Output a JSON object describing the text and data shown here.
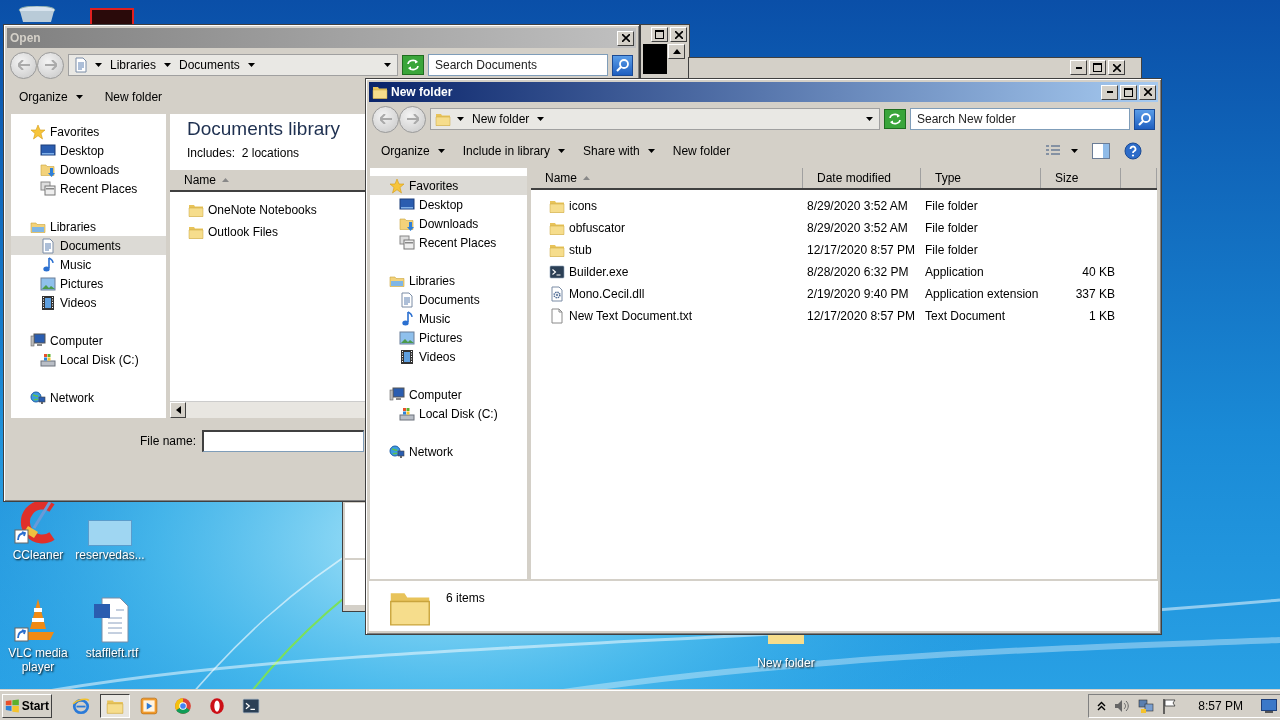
{
  "desktop": {
    "icons": [
      {
        "label": "CCleaner",
        "kind": "ccleaner",
        "shortcut": true
      },
      {
        "label": "reservedas...",
        "kind": "blank",
        "shortcut": false
      },
      {
        "label": "VLC media player",
        "kind": "vlc",
        "shortcut": true
      },
      {
        "label": "staffleft.rtf",
        "kind": "word",
        "shortcut": false
      },
      {
        "label": "New folder",
        "kind": "folder",
        "shortcut": false
      }
    ]
  },
  "open_dialog": {
    "title": "Open",
    "active": false,
    "address": {
      "kind": "documents",
      "crumbs": [
        "Libraries",
        "Documents"
      ]
    },
    "search_placeholder": "Search Documents",
    "toolbar": [
      {
        "label": "Organize",
        "dropdown": true
      },
      {
        "label": "New folder",
        "dropdown": false
      }
    ],
    "nav": [
      {
        "label": "Favorites",
        "kind": "star",
        "selected": false,
        "children": [
          {
            "label": "Desktop",
            "kind": "desktop",
            "selected": false
          },
          {
            "label": "Downloads",
            "kind": "downloads",
            "selected": false
          },
          {
            "label": "Recent Places",
            "kind": "recent",
            "selected": false
          }
        ]
      },
      {
        "label": "Libraries",
        "kind": "library",
        "selected": false,
        "children": [
          {
            "label": "Documents",
            "kind": "documents",
            "selected": true
          },
          {
            "label": "Music",
            "kind": "music",
            "selected": false
          },
          {
            "label": "Pictures",
            "kind": "pictures",
            "selected": false
          },
          {
            "label": "Videos",
            "kind": "videos",
            "selected": false
          }
        ]
      },
      {
        "label": "Computer",
        "kind": "computer",
        "selected": false,
        "children": [
          {
            "label": "Local Disk (C:)",
            "kind": "disk",
            "selected": false
          }
        ]
      },
      {
        "label": "Network",
        "kind": "network",
        "selected": false
      }
    ],
    "library_title": "Documents library",
    "includes_label": "Includes:",
    "locations_link": "2 locations",
    "columns": [
      {
        "label": "Name",
        "sorted": true
      }
    ],
    "items": [
      {
        "kind": "folder",
        "name": "OneNote Notebooks"
      },
      {
        "kind": "folder",
        "name": "Outlook Files"
      }
    ],
    "file_name_label": "File name:"
  },
  "explorer": {
    "title": "New folder",
    "active": true,
    "address": {
      "kind": "folder",
      "crumbs": [
        "New folder"
      ]
    },
    "search_placeholder": "Search New folder",
    "toolbar": [
      {
        "label": "Organize",
        "dropdown": true
      },
      {
        "label": "Include in library",
        "dropdown": true
      },
      {
        "label": "Share with",
        "dropdown": true
      },
      {
        "label": "New folder",
        "dropdown": false
      }
    ],
    "nav": [
      {
        "label": "Favorites",
        "kind": "star",
        "selected": true,
        "children": [
          {
            "label": "Desktop",
            "kind": "desktop",
            "selected": false
          },
          {
            "label": "Downloads",
            "kind": "downloads",
            "selected": false
          },
          {
            "label": "Recent Places",
            "kind": "recent",
            "selected": false
          }
        ]
      },
      {
        "label": "Libraries",
        "kind": "library",
        "selected": false,
        "children": [
          {
            "label": "Documents",
            "kind": "documents",
            "selected": false
          },
          {
            "label": "Music",
            "kind": "music",
            "selected": false
          },
          {
            "label": "Pictures",
            "kind": "pictures",
            "selected": false
          },
          {
            "label": "Videos",
            "kind": "videos",
            "selected": false
          }
        ]
      },
      {
        "label": "Computer",
        "kind": "computer",
        "selected": false,
        "children": [
          {
            "label": "Local Disk (C:)",
            "kind": "disk",
            "selected": false
          }
        ]
      },
      {
        "label": "Network",
        "kind": "network",
        "selected": false
      }
    ],
    "columns": [
      {
        "label": "Name",
        "sorted": true
      },
      {
        "label": "Date modified",
        "sorted": false
      },
      {
        "label": "Type",
        "sorted": false
      },
      {
        "label": "Size",
        "sorted": false
      }
    ],
    "rows": [
      {
        "kind": "folder",
        "name": "icons",
        "date": "8/29/2020 3:52 AM",
        "type": "File folder"
      },
      {
        "kind": "folder",
        "name": "obfuscator",
        "date": "8/29/2020 3:52 AM",
        "type": "File folder"
      },
      {
        "kind": "folder",
        "name": "stub",
        "date": "12/17/2020 8:57 PM",
        "type": "File folder"
      },
      {
        "kind": "exe",
        "name": "Builder.exe",
        "date": "8/28/2020 6:32 PM",
        "type": "Application",
        "size": "40 KB"
      },
      {
        "kind": "dll",
        "name": "Mono.Cecil.dll",
        "date": "2/19/2020 9:40 PM",
        "type": "Application extension",
        "size": "337 KB"
      },
      {
        "kind": "txt",
        "name": "New Text Document.txt",
        "date": "12/17/2020 8:57 PM",
        "type": "Text Document",
        "size": "1 KB"
      }
    ],
    "status": "6 items"
  },
  "taskbar": {
    "start_label": "Start",
    "apps": [
      {
        "kind": "ie",
        "selected": false
      },
      {
        "kind": "explorer",
        "selected": true
      },
      {
        "kind": "media",
        "selected": false
      },
      {
        "kind": "chrome",
        "selected": false
      },
      {
        "kind": "opera",
        "selected": false
      },
      {
        "kind": "cmd",
        "selected": false
      }
    ],
    "clock": "8:57 PM"
  }
}
